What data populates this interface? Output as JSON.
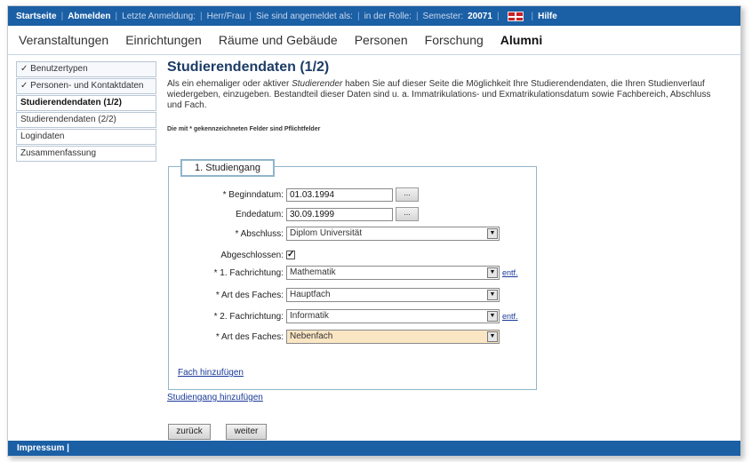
{
  "topbar": {
    "home": "Startseite",
    "logout": "Abmelden",
    "last_login": "Letzte Anmeldung:",
    "salutation": "Herr/Frau",
    "logged_in_as": "Sie sind angemeldet als:",
    "role": "in der Rolle:",
    "semester_label": "Semester:",
    "semester_value": "20071",
    "help": "Hilfe"
  },
  "mainnav": [
    "Veranstaltungen",
    "Einrichtungen",
    "Räume und Gebäude",
    "Personen",
    "Forschung",
    "Alumni"
  ],
  "sidebar": [
    {
      "label": "✓ Benutzertypen"
    },
    {
      "label": "✓ Personen- und Kontaktdaten"
    },
    {
      "label": "Studierendendaten (1/2)"
    },
    {
      "label": "Studierendendaten (2/2)"
    },
    {
      "label": "Logindaten"
    },
    {
      "label": "Zusammenfassung"
    }
  ],
  "page": {
    "title": "Studierendendaten (1/2)",
    "intro_1": "Als ein ehemaliger oder aktiver ",
    "intro_em": "Studierender",
    "intro_2": " haben Sie auf dieser Seite die Möglichkeit Ihre Studierendendaten, die Ihren Studienverlauf wiedergeben, einzugeben. Bestandteil dieser Daten sind u. a. Immatrikulations- und Exmatrikulationsdatum sowie Fachbereich, Abschluss und Fach.",
    "required_note": "Die mit * gekennzeichneten Felder sind Pflichtfelder"
  },
  "study": {
    "legend": "1. Studiengang",
    "begin_label": "* Beginndatum:",
    "begin_value": "01.03.1994",
    "end_label": "Endedatum:",
    "end_value": "30.09.1999",
    "dots": "...",
    "degree_label": "* Abschluss:",
    "degree_value": "Diplom Universität",
    "completed_label": "Abgeschlossen:",
    "completed_mark": "✓",
    "field1_label": "* 1. Fachrichtung:",
    "field1_value": "Mathematik",
    "type1_label": "* Art des Faches:",
    "type1_value": "Hauptfach",
    "field2_label": "* 2. Fachrichtung:",
    "field2_value": "Informatik",
    "type2_label": "* Art des Faches:",
    "type2_value": "Nebenfach",
    "remove": "entf.",
    "dropdown_arrow": "▼",
    "add_subject": "Fach hinzufügen"
  },
  "add_program": "Studiengang hinzufügen",
  "buttons": {
    "back": "zurück",
    "next": "weiter"
  },
  "footer": {
    "imprint": "Impressum |"
  }
}
